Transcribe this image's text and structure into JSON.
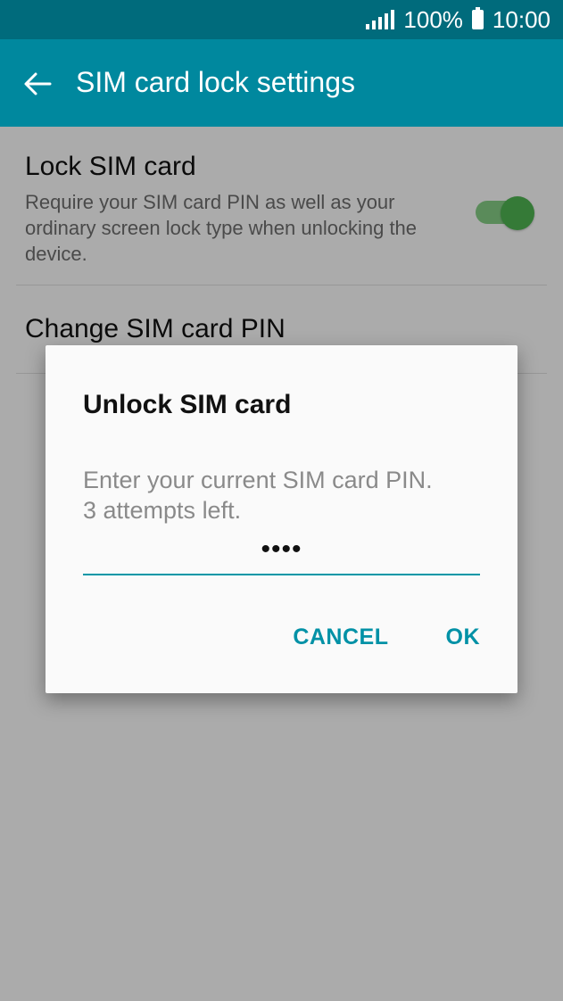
{
  "status_bar": {
    "battery_text": "100%",
    "time": "10:00",
    "icons": [
      "signal-icon",
      "battery-icon"
    ]
  },
  "app_bar": {
    "title": "SIM card lock settings",
    "back_icon": "arrow-left-icon"
  },
  "settings": {
    "lock_sim": {
      "title": "Lock SIM card",
      "summary": "Require your SIM card PIN as well as your ordinary screen lock type when unlocking the device.",
      "enabled": true
    },
    "change_pin": {
      "title": "Change SIM card PIN"
    }
  },
  "dialog": {
    "title": "Unlock SIM card",
    "message_line1": "Enter your current SIM card PIN.",
    "message_line2": "3 attempts left.",
    "pin_masked": "••••",
    "cancel_label": "CANCEL",
    "ok_label": "OK"
  },
  "colors": {
    "status_bar": "#006b7c",
    "app_bar": "#00889e",
    "accent": "#0091a6",
    "toggle_on": "#4caf50"
  }
}
